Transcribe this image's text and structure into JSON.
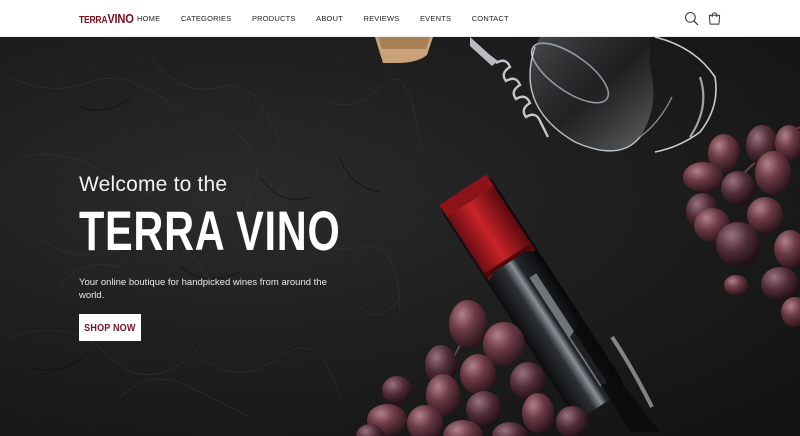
{
  "brand": {
    "logo_part1": "TERRA",
    "logo_part2": "VINO",
    "color": "#7a1020"
  },
  "nav": {
    "items": [
      {
        "label": "HOME"
      },
      {
        "label": "CATEGORIES"
      },
      {
        "label": "PRODUCTS"
      },
      {
        "label": "ABOUT"
      },
      {
        "label": "REVIEWS"
      },
      {
        "label": "EVENTS"
      },
      {
        "label": "CONTACT"
      }
    ],
    "icons": [
      "search-icon",
      "shopping-bag-icon"
    ]
  },
  "hero": {
    "welcome": "Welcome to the",
    "title": "TERRA VINO",
    "tagline": "Your online boutique for handpicked wines from around the world.",
    "cta_label": "SHOP NOW",
    "image": "wine bottle, glass, corkscrew and red grapes on dark stone"
  }
}
